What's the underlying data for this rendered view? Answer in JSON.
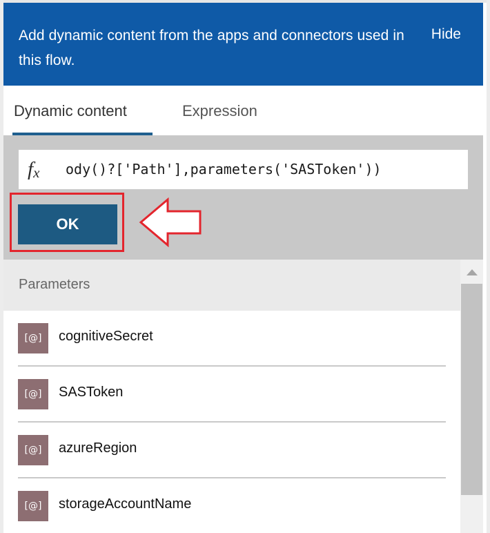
{
  "banner": {
    "text": "Add dynamic content from the apps and connectors used in this flow.",
    "hide_label": "Hide"
  },
  "tabs": [
    {
      "label": "Dynamic content",
      "active": true
    },
    {
      "label": "Expression",
      "active": false
    }
  ],
  "expression": {
    "fx_icon": "function-fx-icon",
    "value": "ody()?['Path'],parameters('SASToken'))"
  },
  "ok_button": {
    "label": "OK"
  },
  "annotation": {
    "highlight_color": "#e3252d",
    "arrow": "left-arrow-outline"
  },
  "parameters": {
    "section_label": "Parameters",
    "items": [
      {
        "icon_text": "[@]",
        "label": "cognitiveSecret"
      },
      {
        "icon_text": "[@]",
        "label": "SASToken"
      },
      {
        "icon_text": "[@]",
        "label": "azureRegion"
      },
      {
        "icon_text": "[@]",
        "label": "storageAccountName"
      }
    ]
  },
  "colors": {
    "banner": "#0f5aa7",
    "ok_button": "#1d5a82",
    "param_icon": "#8d6e72",
    "expr_panel": "#c8c8c8"
  }
}
